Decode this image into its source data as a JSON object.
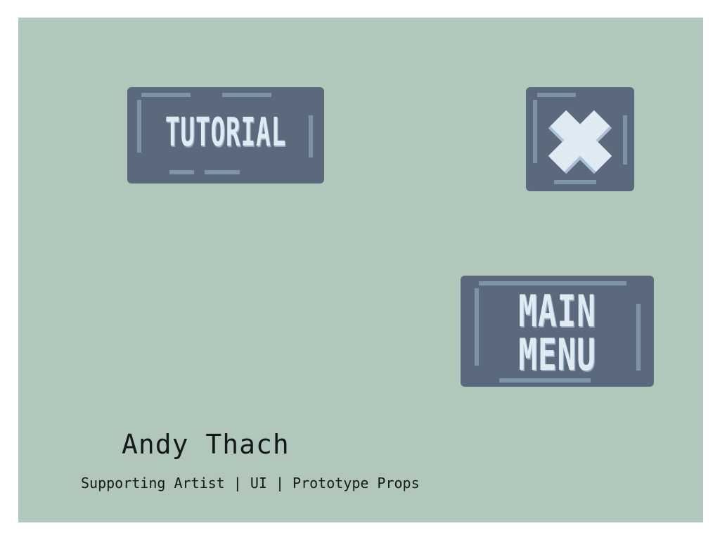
{
  "buttons": {
    "tutorial_label": "TUTORIAL",
    "close_icon": "close-x-icon",
    "main_menu_line1": "MAIN",
    "main_menu_line2": "MENU"
  },
  "credit": {
    "name": "Andy Thach",
    "role": "Supporting Artist | UI | Prototype Props"
  },
  "colors": {
    "background": "#b1c7bb",
    "button_fill": "#5a6a7c",
    "button_frame": "#7e92a8",
    "button_text": "#dfeaf3",
    "credit_text": "#15191c"
  }
}
